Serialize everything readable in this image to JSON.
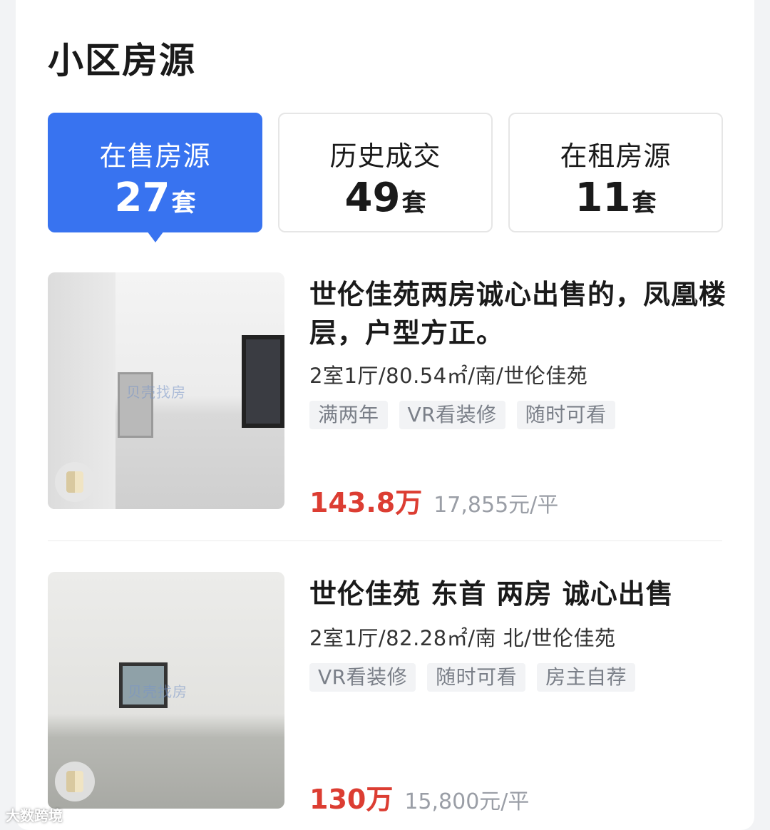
{
  "section": {
    "title": "小区房源"
  },
  "tabs": [
    {
      "label": "在售房源",
      "count": "27",
      "unit": "套",
      "active": true
    },
    {
      "label": "历史成交",
      "count": "49",
      "unit": "套",
      "active": false
    },
    {
      "label": "在租房源",
      "count": "11",
      "unit": "套",
      "active": false
    }
  ],
  "listings": [
    {
      "title": "世伦佳苑两房诚心出售的，凤凰楼层，户型方正。",
      "meta": "2室1厅/80.54㎡/南/世伦佳苑",
      "tags": [
        "满两年",
        "VR看装修",
        "随时可看"
      ],
      "price": "143.8万",
      "unit_price": "17,855元/平",
      "watermark": "贝壳找房"
    },
    {
      "title": "世伦佳苑 东首 两房 诚心出售",
      "meta": "2室1厅/82.28㎡/南 北/世伦佳苑",
      "tags": [
        "VR看装修",
        "随时可看",
        "房主自荐"
      ],
      "price": "130万",
      "unit_price": "15,800元/平",
      "watermark": "贝壳找房"
    }
  ],
  "footer": {
    "watermark": "大数跨境"
  },
  "colors": {
    "accent": "#3873f0",
    "price": "#dc3d32",
    "tag_bg": "#f2f3f5"
  }
}
